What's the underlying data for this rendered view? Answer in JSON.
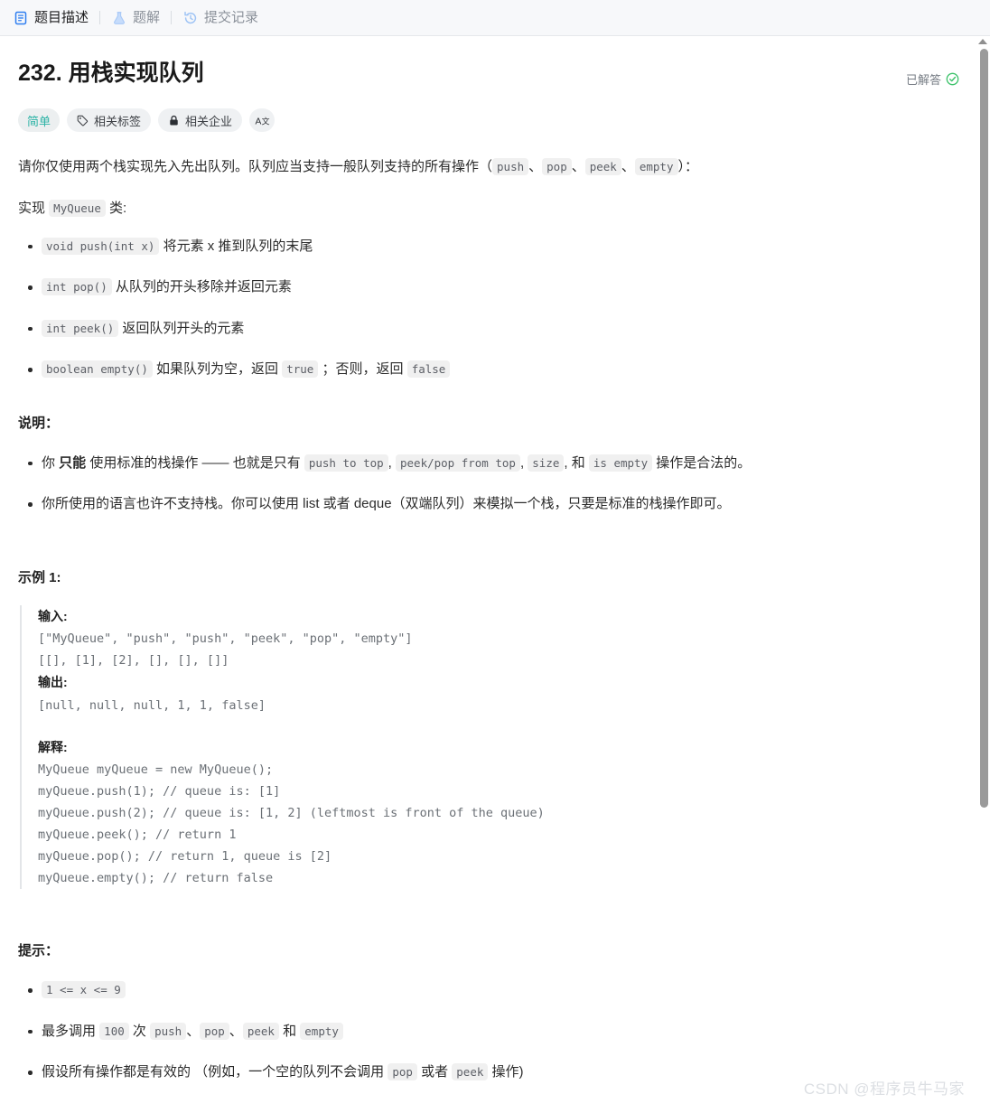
{
  "tabs": [
    {
      "label": "题目描述",
      "icon": "document-icon",
      "active": true
    },
    {
      "label": "题解",
      "icon": "flask-icon",
      "active": false
    },
    {
      "label": "提交记录",
      "icon": "history-icon",
      "active": false
    }
  ],
  "header": {
    "title": "232. 用栈实现队列",
    "solved_label": "已解答",
    "check_icon": "check-circle-icon"
  },
  "badges": {
    "difficulty": "简单",
    "tags": "相关标签",
    "companies": "相关企业",
    "translate_icon": "translate-icon"
  },
  "description": {
    "intro_1": "请你仅使用两个栈实现先入先出队列。队列应当支持一般队列支持的所有操作（",
    "intro_code_1": "push",
    "sep_1": "、",
    "intro_code_2": "pop",
    "sep_2": "、",
    "intro_code_3": "peek",
    "sep_3": "、",
    "intro_code_4": "empty",
    "intro_2": "）：",
    "implement_prefix": "实现 ",
    "implement_class": "MyQueue",
    "implement_suffix": " 类:",
    "methods": [
      {
        "code": "void push(int x)",
        "text": " 将元素 x 推到队列的末尾"
      },
      {
        "code": "int pop()",
        "text": " 从队列的开头移除并返回元素"
      },
      {
        "code": "int peek()",
        "text": " 返回队列开头的元素"
      }
    ],
    "method_empty": {
      "code": "boolean empty()",
      "text_1": " 如果队列为空，返回 ",
      "code_true": "true",
      "text_2": " ；否则，返回 ",
      "code_false": "false"
    }
  },
  "notes": {
    "title": "说明：",
    "item1": {
      "a": "你 ",
      "strong": "只能",
      "b": " 使用标准的栈操作 —— 也就是只有 ",
      "c1": "push to top",
      "s1": ", ",
      "c2": "peek/pop from top",
      "s2": ", ",
      "c3": "size",
      "s3": ", 和 ",
      "c4": "is empty",
      "d": " 操作是合法的。"
    },
    "item2": "你所使用的语言也许不支持栈。你可以使用 list 或者 deque（双端队列）来模拟一个栈，只要是标准的栈操作即可。"
  },
  "example": {
    "title": "示例 1:",
    "input_label": "输入:",
    "input_lines": [
      "[\"MyQueue\", \"push\", \"push\", \"peek\", \"pop\", \"empty\"]",
      "[[], [1], [2], [], [], []]"
    ],
    "output_label": "输出:",
    "output_lines": [
      "[null, null, null, 1, 1, false]"
    ],
    "explain_label": "解释:",
    "explain_lines": [
      "MyQueue myQueue = new MyQueue();",
      "myQueue.push(1); // queue is: [1]",
      "myQueue.push(2); // queue is: [1, 2] (leftmost is front of the queue)",
      "myQueue.peek(); // return 1",
      "myQueue.pop(); // return 1, queue is [2]",
      "myQueue.empty(); // return false"
    ]
  },
  "hints": {
    "title": "提示：",
    "item1_code": "1 <= x <= 9",
    "item2": {
      "a": "最多调用 ",
      "c1": "100",
      "b": " 次 ",
      "c2": "push",
      "s1": "、",
      "c3": "pop",
      "s2": "、",
      "c4": "peek",
      "c": " 和 ",
      "c5": "empty"
    },
    "item3": {
      "a": "假设所有操作都是有效的 （例如，一个空的队列不会调用 ",
      "c1": "pop",
      "b": " 或者 ",
      "c2": "peek",
      "c": " 操作)"
    }
  },
  "watermark": "CSDN @程序员牛马家",
  "colors": {
    "accent": "#2db3a6",
    "tab_active_icon": "#3b82f6",
    "solved_check": "#3cc26a"
  }
}
